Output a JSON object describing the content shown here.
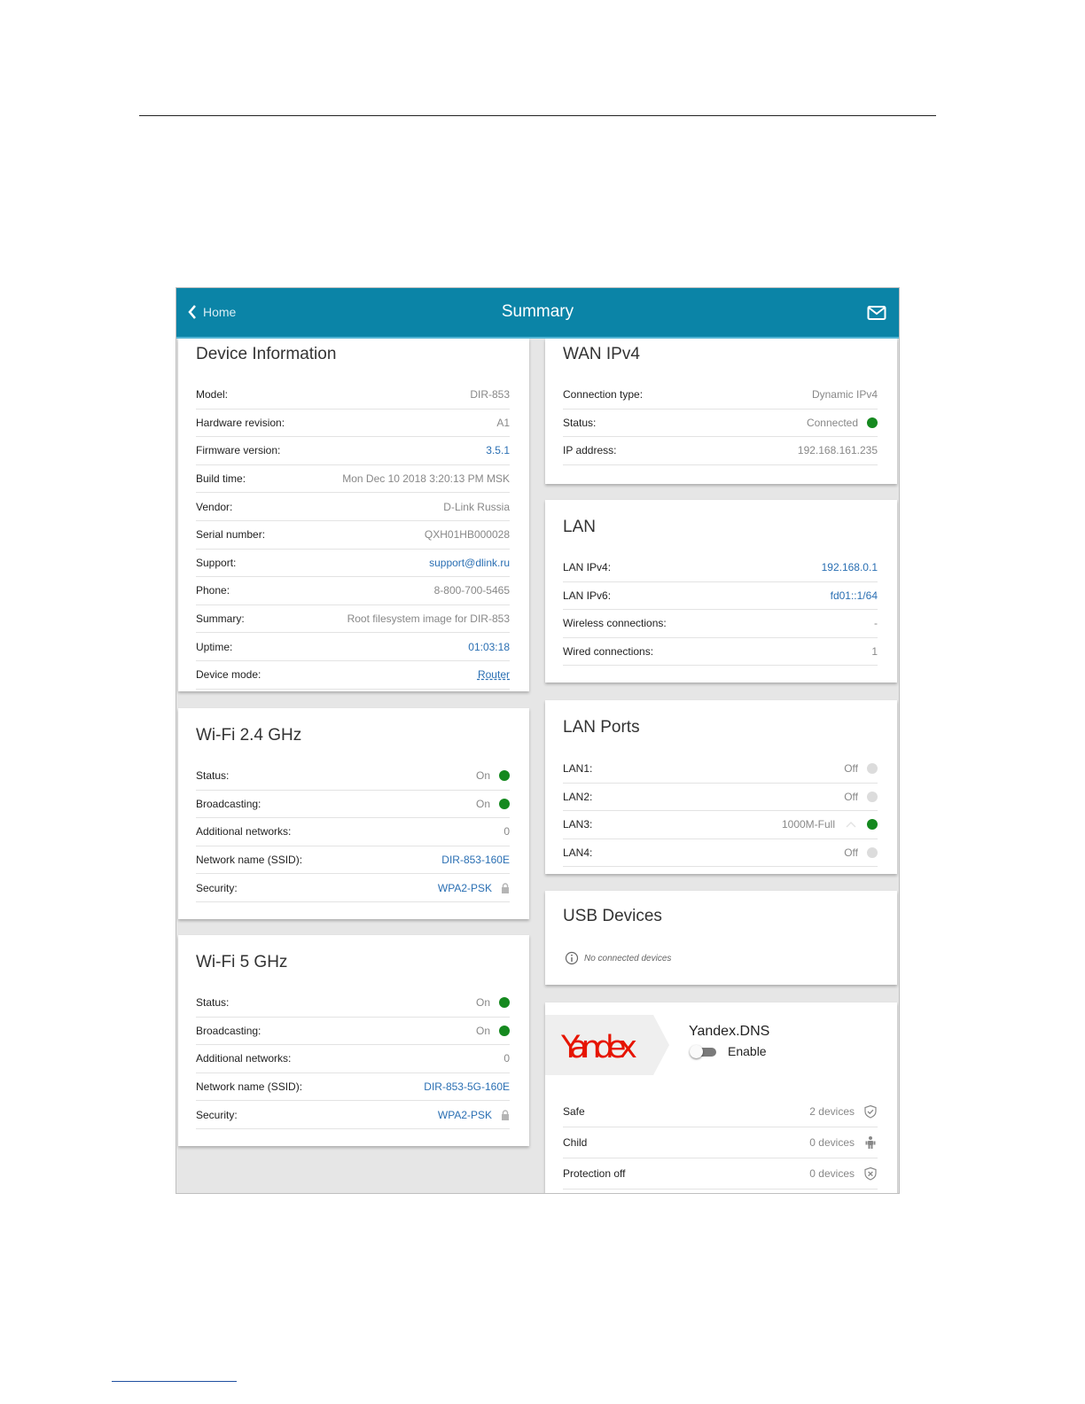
{
  "header": {
    "back_label": "Home",
    "title": "Summary"
  },
  "device_info": {
    "title": "Device Information",
    "rows": [
      {
        "label": "Model:",
        "value": "DIR-853"
      },
      {
        "label": "Hardware revision:",
        "value": "A1"
      },
      {
        "label": "Firmware version:",
        "value": "3.5.1"
      },
      {
        "label": "Build time:",
        "value": "Mon Dec 10 2018 3:20:13 PM MSK"
      },
      {
        "label": "Vendor:",
        "value": "D-Link Russia"
      },
      {
        "label": "Serial number:",
        "value": "QXH01HB000028"
      },
      {
        "label": "Support:",
        "value": "support@dlink.ru"
      },
      {
        "label": "Phone:",
        "value": "8-800-700-5465"
      },
      {
        "label": "Summary:",
        "value": "Root filesystem image for DIR-853"
      },
      {
        "label": "Uptime:",
        "value": "01:03:18"
      },
      {
        "label": "Device mode:",
        "value": "Router"
      }
    ]
  },
  "wifi24": {
    "title": "Wi-Fi 2.4 GHz",
    "rows": [
      {
        "label": "Status:",
        "value": "On"
      },
      {
        "label": "Broadcasting:",
        "value": "On"
      },
      {
        "label": "Additional networks:",
        "value": "0"
      },
      {
        "label": "Network name (SSID):",
        "value": "DIR-853-160E"
      },
      {
        "label": "Security:",
        "value": "WPA2-PSK"
      }
    ]
  },
  "wifi5": {
    "title": "Wi-Fi 5 GHz",
    "rows": [
      {
        "label": "Status:",
        "value": "On"
      },
      {
        "label": "Broadcasting:",
        "value": "On"
      },
      {
        "label": "Additional networks:",
        "value": "0"
      },
      {
        "label": "Network name (SSID):",
        "value": "DIR-853-5G-160E"
      },
      {
        "label": "Security:",
        "value": "WPA2-PSK"
      }
    ]
  },
  "wan": {
    "title": "WAN IPv4",
    "rows": [
      {
        "label": "Connection type:",
        "value": "Dynamic IPv4"
      },
      {
        "label": "Status:",
        "value": "Connected"
      },
      {
        "label": "IP address:",
        "value": "192.168.161.235"
      }
    ]
  },
  "lan": {
    "title": "LAN",
    "rows": [
      {
        "label": "LAN IPv4:",
        "value": "192.168.0.1"
      },
      {
        "label": "LAN IPv6:",
        "value": "fd01::1/64"
      },
      {
        "label": "Wireless connections:",
        "value": "-"
      },
      {
        "label": "Wired connections:",
        "value": "1"
      }
    ]
  },
  "lan_ports": {
    "title": "LAN Ports",
    "rows": [
      {
        "label": "LAN1:",
        "value": "Off"
      },
      {
        "label": "LAN2:",
        "value": "Off"
      },
      {
        "label": "LAN3:",
        "value": "1000M-Full"
      },
      {
        "label": "LAN4:",
        "value": "Off"
      }
    ]
  },
  "usb": {
    "title": "USB Devices",
    "note": "No connected devices"
  },
  "yandex": {
    "logo_text": "Yandex",
    "title": "Yandex.DNS",
    "enable_label": "Enable",
    "rows": [
      {
        "label": "Safe",
        "value": "2 devices",
        "icon": "shield-check-icon"
      },
      {
        "label": "Child",
        "value": "0 devices",
        "icon": "child-icon"
      },
      {
        "label": "Protection off",
        "value": "0 devices",
        "icon": "shield-x-icon"
      }
    ]
  },
  "colors": {
    "header": "#0b84a7",
    "status_on": "#15891f",
    "status_off": "#dcdcdc",
    "link": "#2a6fb3",
    "yandex_red": "#e61400"
  }
}
